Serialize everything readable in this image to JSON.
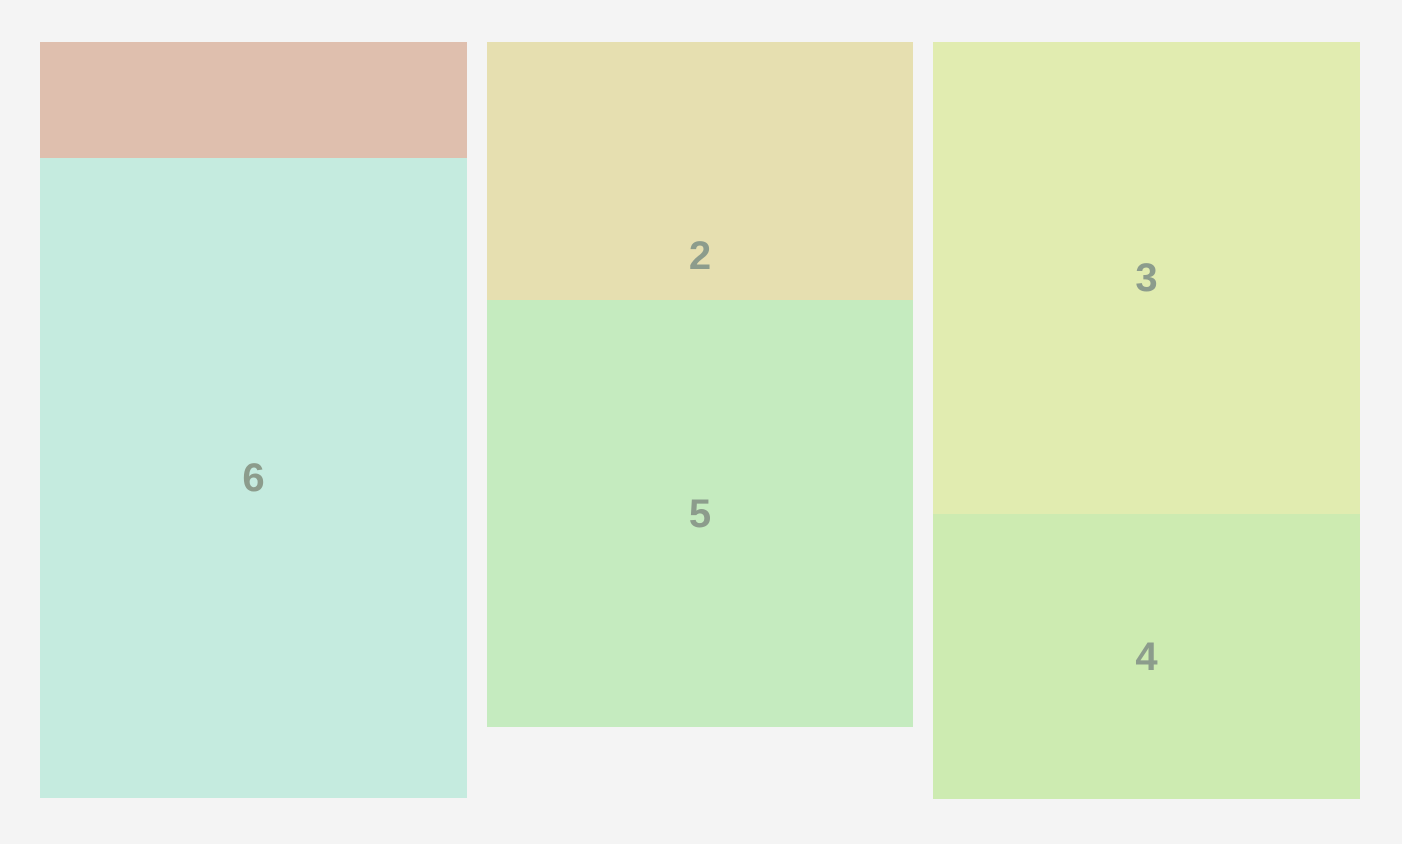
{
  "colors": {
    "background": "#f4f4f4",
    "label": "#8c9c8c"
  },
  "tiles": [
    {
      "label": "",
      "color": "#dfbfae"
    },
    {
      "label": "6",
      "color": "#c5ebdf"
    },
    {
      "label": "2",
      "color": "#e6dfb0"
    },
    {
      "label": "5",
      "color": "#c5ebbf"
    },
    {
      "label": "3",
      "color": "#e1ecb0"
    },
    {
      "label": "4",
      "color": "#cdebb1"
    }
  ]
}
